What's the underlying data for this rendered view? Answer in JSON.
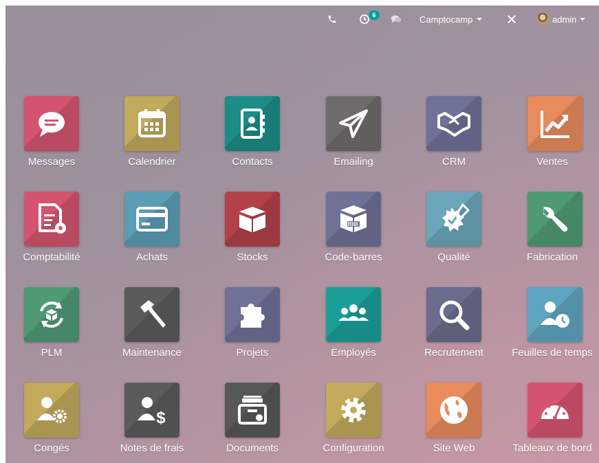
{
  "topbar": {
    "icons": {
      "phone": "phone-icon",
      "activity": "clock-activity-icon",
      "chat": "chat-icon",
      "debug": "bug-debug-icon"
    },
    "activity_count": "6",
    "company": "Camptocamp",
    "user": "admin"
  },
  "apps": [
    {
      "label": "Messages",
      "icon": "chat-bubble-icon",
      "color": "#d4546f"
    },
    {
      "label": "Calendrier",
      "icon": "calendar-icon",
      "color": "#c2a95c"
    },
    {
      "label": "Contacts",
      "icon": "address-book-icon",
      "color": "#1b8c86"
    },
    {
      "label": "Emailing",
      "icon": "paper-plane-icon",
      "color": "#6e6b6a"
    },
    {
      "label": "CRM",
      "icon": "handshake-icon",
      "color": "#6f7196"
    },
    {
      "label": "Ventes",
      "icon": "chart-up-icon",
      "color": "#e88b5d"
    },
    {
      "label": "Comptabilité",
      "icon": "invoice-gear-icon",
      "color": "#d4546f"
    },
    {
      "label": "Achats",
      "icon": "credit-card-icon",
      "color": "#5a9db4"
    },
    {
      "label": "Stocks",
      "icon": "box-icon",
      "color": "#b3414a"
    },
    {
      "label": "Code-barres",
      "icon": "barcode-box-icon",
      "color": "#6f7196"
    },
    {
      "label": "Qualité",
      "icon": "seal-pen-icon",
      "color": "#6aa5b9"
    },
    {
      "label": "Fabrication",
      "icon": "wrench-icon",
      "color": "#4f9a74"
    },
    {
      "label": "PLM",
      "icon": "cycle-box-icon",
      "color": "#4f9a74"
    },
    {
      "label": "Maintenance",
      "icon": "hammer-icon",
      "color": "#5c5b5c"
    },
    {
      "label": "Projets",
      "icon": "puzzle-icon",
      "color": "#6f7196"
    },
    {
      "label": "Employés",
      "icon": "users-icon",
      "color": "#1b9e98"
    },
    {
      "label": "Recrutement",
      "icon": "magnifier-icon",
      "color": "#6a6c8c"
    },
    {
      "label": "Feuilles de temps",
      "icon": "user-clock-icon",
      "color": "#5ea5bf"
    },
    {
      "label": "Congés",
      "icon": "user-gear-icon",
      "color": "#c2a95c"
    },
    {
      "label": "Notes de frais",
      "icon": "user-dollar-icon",
      "color": "#5c5b5c"
    },
    {
      "label": "Documents",
      "icon": "archive-box-icon",
      "color": "#585858"
    },
    {
      "label": "Configuration",
      "icon": "gear-icon",
      "color": "#c2a95c"
    },
    {
      "label": "Site Web",
      "icon": "globe-icon",
      "color": "#e88b5d"
    },
    {
      "label": "Tableaux de bord",
      "icon": "gauge-icon",
      "color": "#d4546f"
    }
  ]
}
